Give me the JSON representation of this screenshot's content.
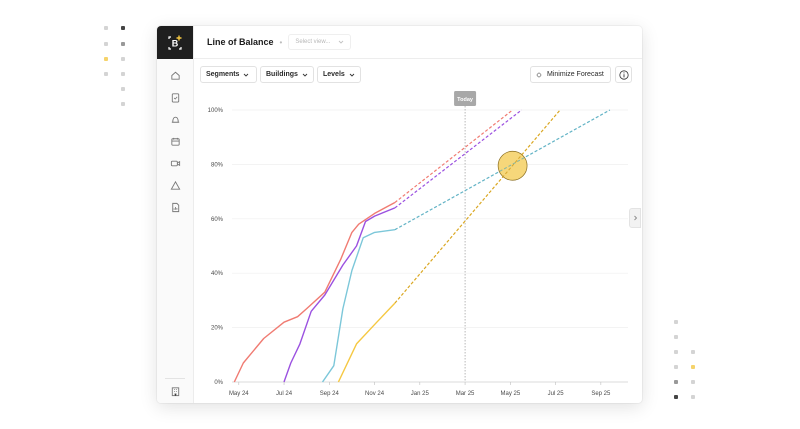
{
  "app": {
    "title": "Line of Balance",
    "select_view_placeholder": "Select view...",
    "logo_letter": "B"
  },
  "toolbar": {
    "segments_label": "Segments",
    "buildings_label": "Buildings",
    "levels_label": "Levels",
    "minimize_label": "Minimize Forecast"
  },
  "rail": {
    "items": [
      "home-icon",
      "clipboard-icon",
      "hardhat-icon",
      "calendar-icon",
      "video-icon",
      "warning-icon",
      "report-icon"
    ],
    "bottom": "building-icon"
  },
  "colors": {
    "red": "#f07b72",
    "purple": "#9b51e0",
    "blue": "#7cc7d9",
    "yellow": "#f5c842",
    "highlight": "#f5d36b"
  },
  "chart_data": {
    "type": "line",
    "today_label": "Today",
    "today_x": 10,
    "x_ticks": [
      {
        "v": 0,
        "label": "May 24"
      },
      {
        "v": 2,
        "label": "Jul 24"
      },
      {
        "v": 4,
        "label": "Sep 24"
      },
      {
        "v": 6,
        "label": "Nov 24"
      },
      {
        "v": 8,
        "label": "Jan 25"
      },
      {
        "v": 10,
        "label": "Mar 25"
      },
      {
        "v": 12,
        "label": "May 25"
      },
      {
        "v": 14,
        "label": "Jul 25"
      },
      {
        "v": 16,
        "label": "Sep 25"
      }
    ],
    "y_ticks": [
      {
        "v": 0,
        "label": "0%"
      },
      {
        "v": 20,
        "label": "20%"
      },
      {
        "v": 40,
        "label": "40%"
      },
      {
        "v": 60,
        "label": "60%"
      },
      {
        "v": 80,
        "label": "80%"
      },
      {
        "v": 100,
        "label": "100%"
      }
    ],
    "xlim": [
      -0.3,
      17.2
    ],
    "ylim": [
      0,
      100
    ],
    "series": [
      {
        "color_key": "red",
        "actual": [
          [
            -0.2,
            0
          ],
          [
            0.2,
            7
          ],
          [
            1.1,
            16
          ],
          [
            2.0,
            22
          ],
          [
            2.6,
            24
          ],
          [
            3.0,
            27
          ],
          [
            3.8,
            33
          ],
          [
            4.5,
            45
          ],
          [
            5.0,
            55
          ],
          [
            5.3,
            58
          ],
          [
            6.0,
            62
          ],
          [
            6.9,
            66
          ]
        ],
        "forecast": [
          [
            6.9,
            66
          ],
          [
            12.1,
            100
          ]
        ]
      },
      {
        "color_key": "purple",
        "actual": [
          [
            2.0,
            0
          ],
          [
            2.3,
            7
          ],
          [
            2.7,
            14
          ],
          [
            3.2,
            26
          ],
          [
            3.8,
            32
          ],
          [
            4.6,
            43
          ],
          [
            5.2,
            50
          ],
          [
            5.6,
            59
          ],
          [
            6.0,
            61
          ],
          [
            6.9,
            64
          ]
        ],
        "forecast": [
          [
            6.9,
            64
          ],
          [
            12.5,
            100
          ]
        ]
      },
      {
        "color_key": "blue",
        "actual": [
          [
            3.7,
            0
          ],
          [
            4.2,
            6
          ],
          [
            4.6,
            27
          ],
          [
            5.0,
            41
          ],
          [
            5.5,
            53
          ],
          [
            6.0,
            55
          ],
          [
            6.9,
            56
          ]
        ],
        "forecast": [
          [
            6.9,
            56
          ],
          [
            16.4,
            100
          ]
        ]
      },
      {
        "color_key": "yellow",
        "actual": [
          [
            4.4,
            0
          ],
          [
            5.2,
            14
          ],
          [
            6.1,
            22
          ],
          [
            6.9,
            29
          ]
        ],
        "forecast": [
          [
            6.9,
            29
          ],
          [
            14.2,
            100
          ]
        ]
      }
    ],
    "highlight_point": [
      12.1,
      79.5
    ]
  }
}
